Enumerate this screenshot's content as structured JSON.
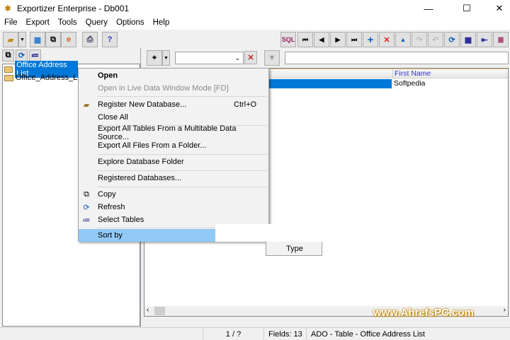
{
  "window": {
    "title": "Exportizer Enterprise - Db001",
    "minimize": "—",
    "maximize": "☐",
    "close": "✕"
  },
  "menubar": [
    "File",
    "Export",
    "Tools",
    "Query",
    "Options",
    "Help"
  ],
  "tree": {
    "items": [
      "Office Address List",
      "Office_Address_List"
    ],
    "selected_index": 0
  },
  "grid": {
    "columns": [
      "First Name"
    ],
    "rows": [
      [
        "Softpedia"
      ]
    ]
  },
  "context_menu": {
    "items": [
      {
        "label": "Open",
        "bold": true
      },
      {
        "label": "Open in Live Data Window Mode [FD]",
        "disabled": true
      },
      {
        "label": "Register New Database...",
        "shortcut": "Ctrl+O",
        "icon": "folder-open-icon"
      },
      {
        "label": "Close All"
      },
      {
        "label": "Export All Tables From a Multitable Data Source..."
      },
      {
        "label": "Export All Files From a Folder..."
      },
      {
        "label": "Explore Database Folder"
      },
      {
        "label": "Registered Databases..."
      },
      {
        "label": "Copy",
        "icon": "copy-icon"
      },
      {
        "label": "Refresh",
        "icon": "refresh-icon"
      },
      {
        "label": "Select Tables",
        "icon": "select-tables-icon"
      },
      {
        "label": "Sort by",
        "highlighted": true
      }
    ],
    "submenu": [
      "Type"
    ]
  },
  "status": {
    "position": "1 / ?",
    "fields": "Fields: 13",
    "source": "ADO - Table - Office Address List"
  },
  "watermark": "www.AhrefsPC.com",
  "colors": {
    "selection": "#0078d7",
    "menu_highlight": "#91c9f7",
    "header_text": "#3333cc"
  }
}
